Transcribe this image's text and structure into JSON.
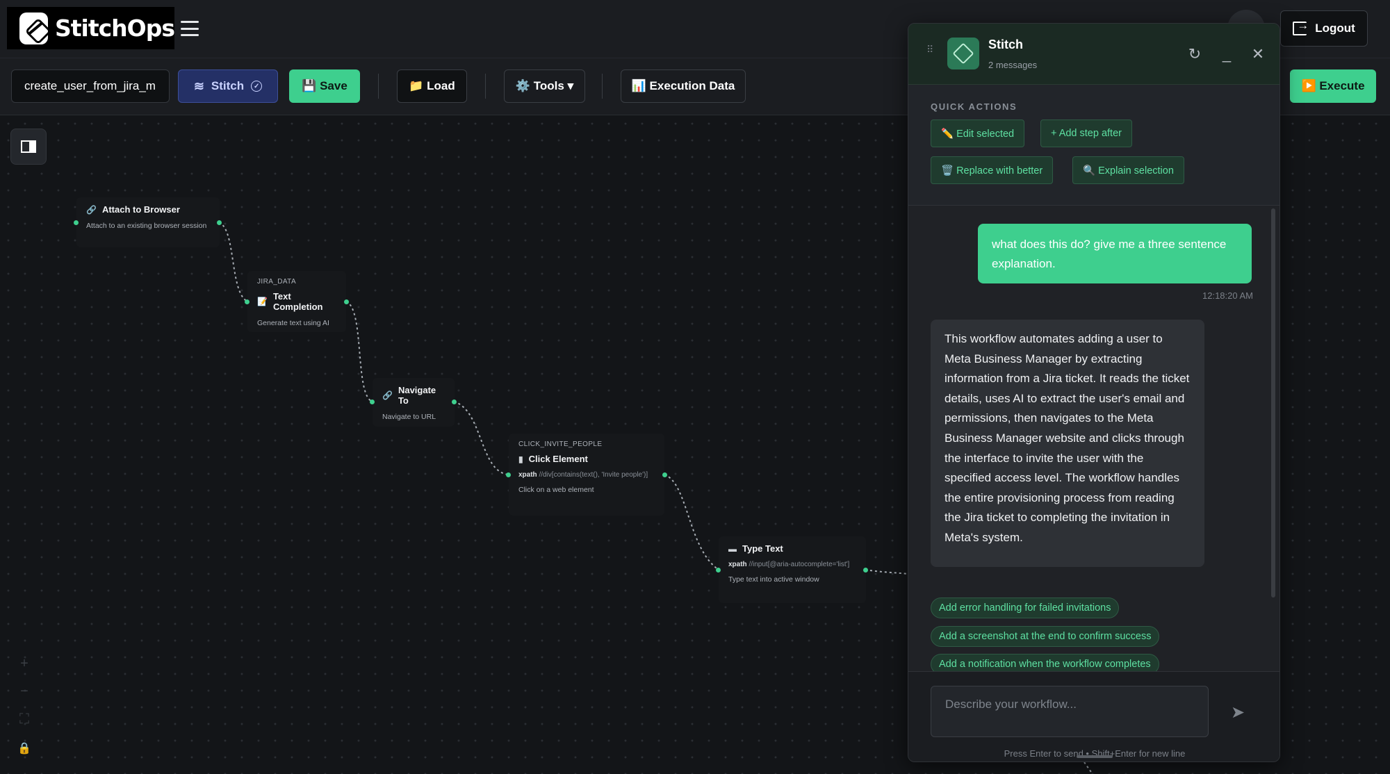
{
  "app": {
    "name": "StitchOps"
  },
  "header": {
    "logout_label": "Logout"
  },
  "toolbar": {
    "workflow_name": "create_user_from_jira_m",
    "stitch_label": "Stitch",
    "save_label": "💾 Save",
    "load_label": "📁 Load",
    "tools_label": "⚙️ Tools ▾",
    "execution_label": "📊 Execution Data",
    "execute_label": "▶️ Execute"
  },
  "nodes": [
    {
      "label": "",
      "title": "Attach to Browser",
      "icon": "🔗",
      "description": "Attach to an existing browser session",
      "xpath": ""
    },
    {
      "label": "JIRA_DATA",
      "title": "Text Completion",
      "icon": "📝",
      "description": "Generate text using AI",
      "xpath": ""
    },
    {
      "label": "",
      "title": "Navigate To",
      "icon": "🔗",
      "description": "Navigate to URL",
      "xpath": ""
    },
    {
      "label": "CLICK_INVITE_PEOPLE",
      "title": "Click Element",
      "icon": "▮",
      "description": "Click on a web element",
      "xpath_key": "xpath",
      "xpath": "//div[contains(text(), 'Invite people')]"
    },
    {
      "label": "",
      "title": "Type Text",
      "icon": "▬",
      "description": "Type text into active window",
      "xpath_key": "xpath",
      "xpath": "//input[@aria-autocomplete='list']"
    }
  ],
  "zoom_controls": [
    "+",
    "−",
    "⛶",
    "🔒"
  ],
  "chat": {
    "title": "Stitch",
    "subtitle": "2 messages",
    "quick_actions_title": "QUICK ACTIONS",
    "quick_actions": [
      "✏️ Edit selected",
      "+ Add step after",
      "🗑️ Replace with better",
      "🔍 Explain selection"
    ],
    "messages": [
      {
        "role": "user",
        "text": "what does this do? give me a three sentence explanation.",
        "time": "12:18:20 AM"
      },
      {
        "role": "assistant",
        "text": "This workflow automates adding a user to Meta Business Manager by extracting information from a Jira ticket. It reads the ticket details, uses AI to extract the user's email and permissions, then navigates to the Meta Business Manager website and clicks through the interface to invite the user with the specified access level. The workflow handles the entire provisioning process from reading the Jira ticket to completing the invitation in Meta's system."
      }
    ],
    "suggestions": [
      "Add error handling for failed invitations",
      "Add a screenshot at the end to confirm success",
      "Add a notification when the workflow completes"
    ],
    "input_placeholder": "Describe your workflow...",
    "hint": "Press Enter to send • Shift+Enter for new line"
  },
  "colors": {
    "accent": "#3ecf8e",
    "background": "#141619",
    "panel": "#202226",
    "stitch_button": "#243066"
  }
}
